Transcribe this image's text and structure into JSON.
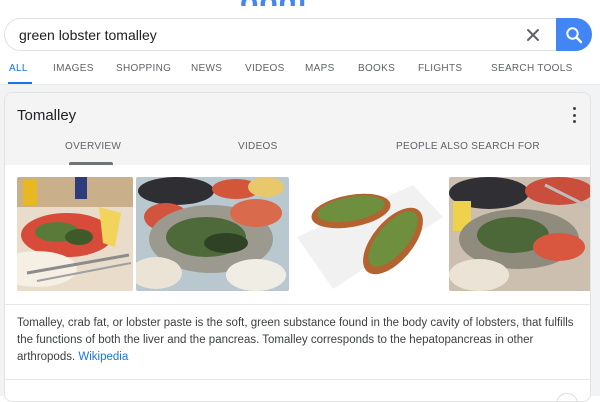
{
  "logo": {
    "text": "oogl"
  },
  "search": {
    "query": "green lobster tomalley"
  },
  "tabs": [
    {
      "label": "ALL",
      "active": true
    },
    {
      "label": "IMAGES"
    },
    {
      "label": "SHOPPING"
    },
    {
      "label": "NEWS"
    },
    {
      "label": "VIDEOS"
    },
    {
      "label": "MAPS"
    },
    {
      "label": "BOOKS"
    },
    {
      "label": "FLIGHTS"
    },
    {
      "label": "SEARCH TOOLS"
    }
  ],
  "card": {
    "title": "Tomalley",
    "tabs": [
      {
        "label": "OVERVIEW",
        "active": true
      },
      {
        "label": "VIDEOS"
      },
      {
        "label": "PEOPLE ALSO SEARCH FOR"
      }
    ],
    "description": "Tomalley, crab fat, or lobster paste is the soft, green substance found in the body cavity of lobsters, that fulfills the functions of both the liver and the pancreas. Tomalley corresponds to the hepatopancreas in other arthropods.",
    "source_link": "Wikipedia"
  },
  "colors": {
    "accent": "#4285f4",
    "link": "#1a73e8"
  }
}
